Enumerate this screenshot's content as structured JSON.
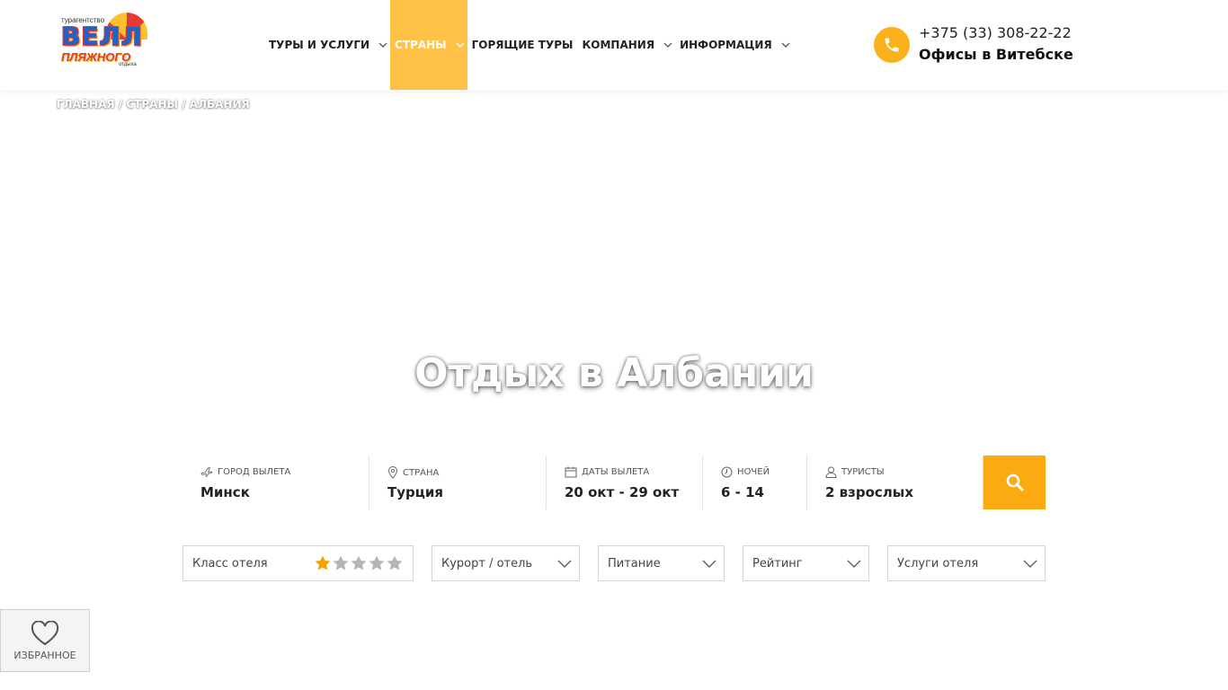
{
  "logo": {
    "top_text": "турагентство",
    "main_text": "ВЕЛЛ",
    "sub_text": "ПЛЯЖНОГО",
    "small_text": "отдыха"
  },
  "nav": {
    "items": [
      {
        "label": "ТУРЫ И УСЛУГИ",
        "has_dropdown": true
      },
      {
        "label": "СТРАНЫ",
        "has_dropdown": true,
        "active": true
      },
      {
        "label": "ГОРЯЩИЕ ТУРЫ",
        "has_dropdown": false
      },
      {
        "label": "КОМПАНИЯ",
        "has_dropdown": true
      },
      {
        "label": "ИНФОРМАЦИЯ",
        "has_dropdown": true
      }
    ]
  },
  "contact": {
    "phone": "+375 (33) 308-22-22",
    "offices": "Офисы в Витебске",
    "icon": "phone-icon"
  },
  "breadcrumb": {
    "items": [
      "ГЛАВНАЯ",
      "СТРАНЫ",
      "АЛБАНИЯ"
    ],
    "separator": "/"
  },
  "hero": {
    "title": "Отдых в Албании"
  },
  "search": {
    "fields": [
      {
        "label": "ГОРОД ВЫЛЕТА",
        "value": "Минск",
        "icon": "plane-icon"
      },
      {
        "label": "СТРАНА",
        "value": "Турция",
        "icon": "location-pin-icon"
      },
      {
        "label": "ДАТЫ ВЫЛЕТА",
        "value": "20 окт - 29 окт",
        "icon": "calendar-icon"
      },
      {
        "label": "НОЧЕЙ",
        "value": "6 - 14",
        "icon": "clock-icon"
      },
      {
        "label": "ТУРИСТЫ",
        "value": "2 взрослых",
        "icon": "user-icon"
      }
    ],
    "button_icon": "search-icon"
  },
  "filters": {
    "hotel_class": {
      "label": "Класс отеля",
      "stars_total": 5,
      "stars_selected": 1
    },
    "resort": {
      "label": "Курорт / отель"
    },
    "meal": {
      "label": "Питание"
    },
    "rating": {
      "label": "Рейтинг"
    },
    "services": {
      "label": "Услуги отеля"
    }
  },
  "favorites": {
    "label": "ИЗБРАННОЕ",
    "icon": "heart-icon"
  },
  "colors": {
    "accent": "#fbaa12",
    "nav_active": "#ffc247",
    "star_active": "#f5a000",
    "star_inactive": "#b5b5b5"
  }
}
